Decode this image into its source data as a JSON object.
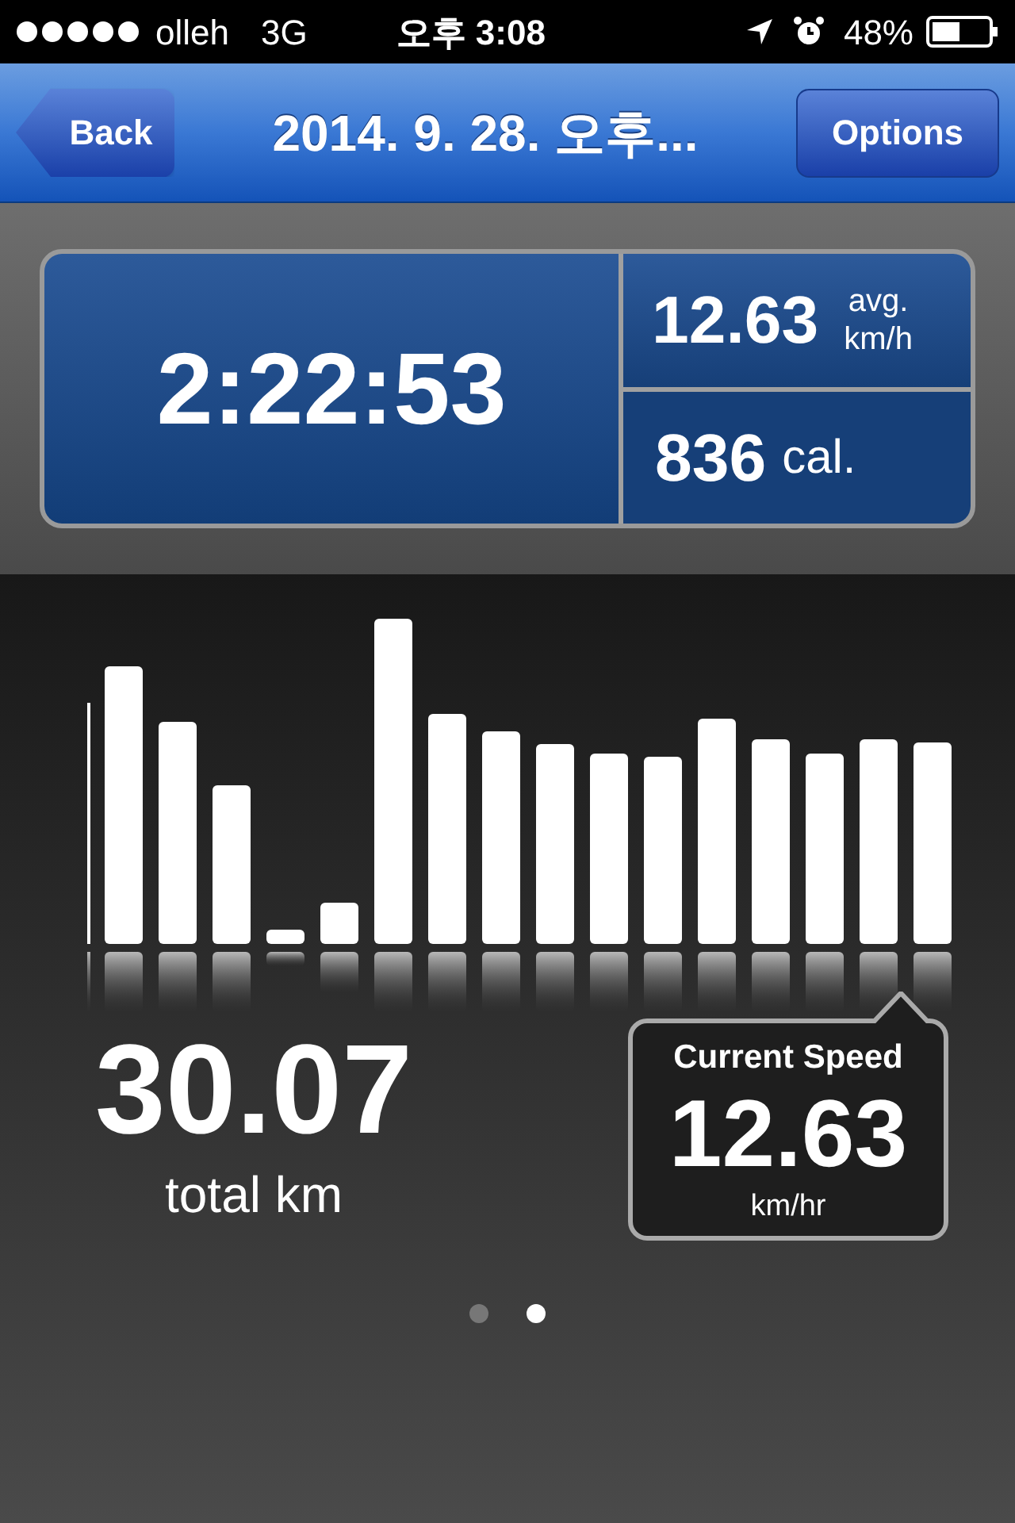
{
  "status_bar": {
    "carrier": "olleh",
    "network": "3G",
    "time": "오후 3:08",
    "battery": "48%"
  },
  "nav_bar": {
    "back": "Back",
    "title": "2014. 9. 28. 오후...",
    "options": "Options"
  },
  "summary": {
    "duration": "2:22:53",
    "avg_speed": "12.63",
    "avg_speed_unit": "avg.\nkm/h",
    "calories": "836",
    "calories_unit": "cal."
  },
  "total": {
    "value": "30.07",
    "label": "total km"
  },
  "current_speed": {
    "title": "Current Speed",
    "value": "12.63",
    "unit": "km/hr"
  },
  "page_dots": [
    {
      "selected": false
    },
    {
      "selected": true
    }
  ]
}
